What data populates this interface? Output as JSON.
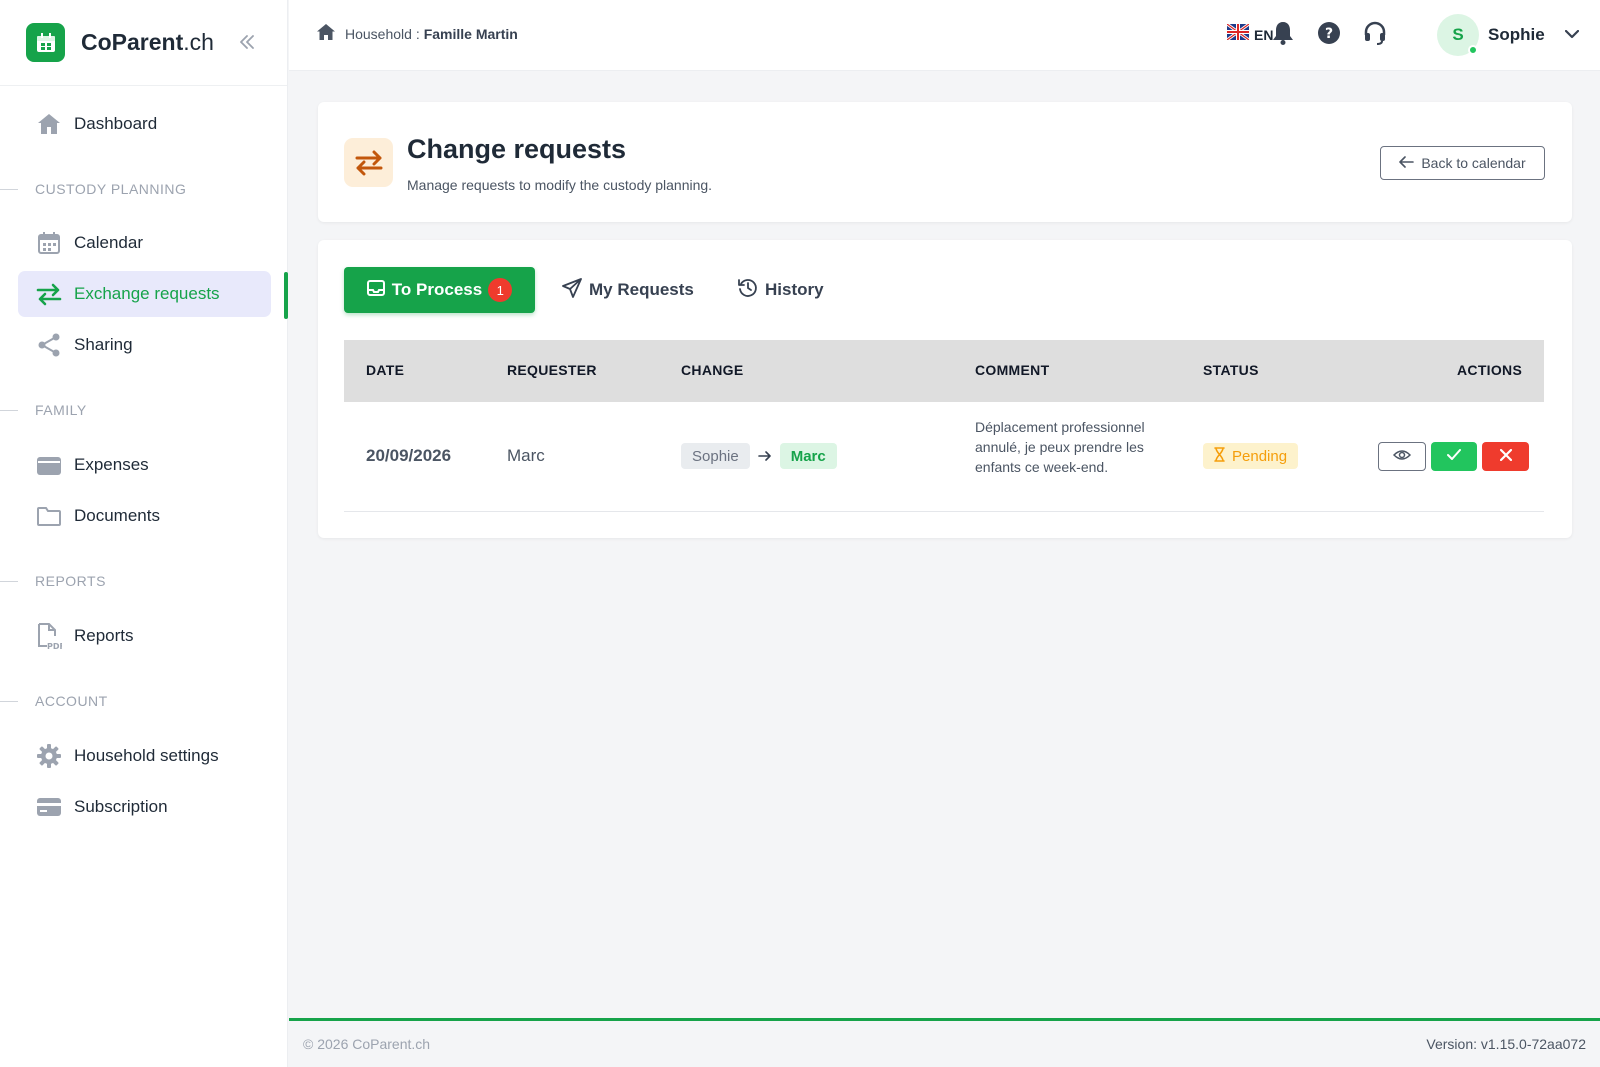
{
  "brand": {
    "name": "CoParent",
    "suffix": ".ch"
  },
  "sidebar": {
    "items": [
      {
        "label": "Dashboard",
        "icon": "home-icon"
      },
      {
        "label": "Calendar",
        "icon": "calendar-icon"
      },
      {
        "label": "Exchange requests",
        "icon": "exchange-icon",
        "active": true
      },
      {
        "label": "Sharing",
        "icon": "share-icon"
      },
      {
        "label": "Expenses",
        "icon": "wallet-icon"
      },
      {
        "label": "Documents",
        "icon": "folder-icon"
      },
      {
        "label": "Reports",
        "icon": "pdf-file-icon"
      },
      {
        "label": "Household settings",
        "icon": "gear-icon"
      },
      {
        "label": "Subscription",
        "icon": "credit-card-icon"
      }
    ],
    "sections": [
      "CUSTODY PLANNING",
      "FAMILY",
      "REPORTS",
      "ACCOUNT"
    ]
  },
  "topbar": {
    "breadcrumb_label": "Household :",
    "breadcrumb_value": "Famille Martin",
    "language": "EN",
    "user": {
      "initial": "S",
      "name": "Sophie"
    }
  },
  "header": {
    "title": "Change requests",
    "subtitle": "Manage requests to modify the custody planning.",
    "back_label": "Back to calendar"
  },
  "tabs": [
    {
      "label": "To Process",
      "badge": "1",
      "active": true
    },
    {
      "label": "My Requests"
    },
    {
      "label": "History"
    }
  ],
  "table": {
    "columns": [
      "DATE",
      "REQUESTER",
      "CHANGE",
      "COMMENT",
      "STATUS",
      "ACTIONS"
    ],
    "rows": [
      {
        "date": "20/09/2026",
        "requester": "Marc",
        "change_from": "Sophie",
        "change_to": "Marc",
        "comment": "Déplacement professionnel annulé, je peux prendre les enfants ce week-end.",
        "status": "Pending"
      }
    ]
  },
  "footer": {
    "copyright": "© 2026 CoParent.ch",
    "version": "Version: v1.15.0-72aa072"
  },
  "colors": {
    "brand_green": "#16a34a",
    "active_nav_bg": "#e8e9fb",
    "badge_red": "#ef3b2d",
    "pending_bg": "#fdf2cc",
    "pending_text": "#f59e0b",
    "accept_green": "#22c55e",
    "reject_red": "#ef3b2d"
  }
}
